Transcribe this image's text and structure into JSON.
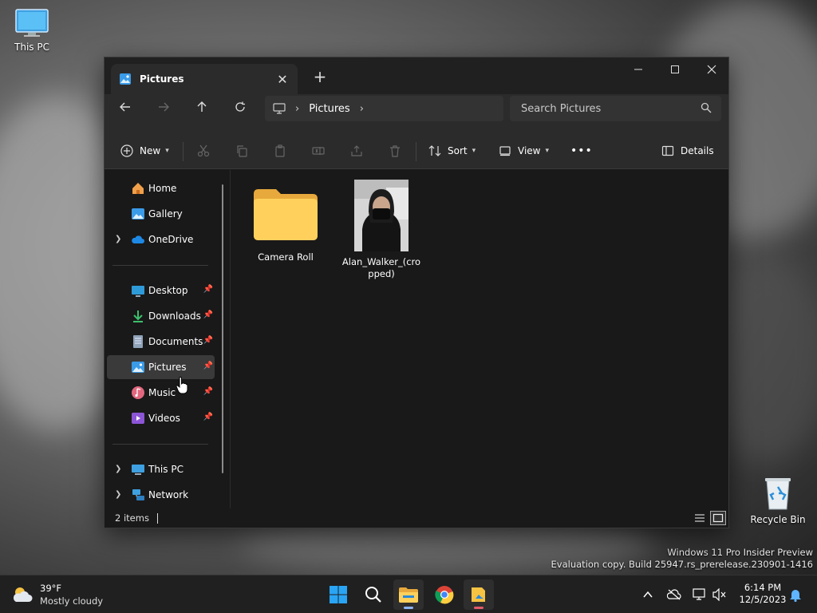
{
  "desktop": {
    "icons": [
      {
        "label": "This PC"
      },
      {
        "label": "Recycle Bin"
      }
    ],
    "watermark": {
      "line1": "Windows 11 Pro Insider Preview",
      "line2": "Evaluation copy. Build 25947.rs_prerelease.230901-1416"
    }
  },
  "window": {
    "tab": {
      "title": "Pictures",
      "close": "✕"
    },
    "new_tab": "+",
    "controls": {
      "minimize": "—",
      "maximize": "☐",
      "close": "✕"
    },
    "address": {
      "root_icon": "computer-icon",
      "crumbs": [
        {
          "label": "Pictures"
        }
      ],
      "search_placeholder": "Search Pictures"
    },
    "toolbar": {
      "new_label": "New",
      "sort_label": "Sort",
      "view_label": "View",
      "more_label": "•••",
      "details_label": "Details"
    },
    "sidebar": {
      "items": [
        {
          "label": "Home"
        },
        {
          "label": "Gallery"
        },
        {
          "label": "OneDrive"
        },
        {
          "label": "Desktop"
        },
        {
          "label": "Downloads"
        },
        {
          "label": "Documents"
        },
        {
          "label": "Pictures"
        },
        {
          "label": "Music"
        },
        {
          "label": "Videos"
        },
        {
          "label": "This PC"
        },
        {
          "label": "Network"
        }
      ]
    },
    "files": [
      {
        "name": "Camera Roll",
        "type": "folder"
      },
      {
        "name_line1": "Alan_Walker_(cro",
        "name_line2": "pped)",
        "type": "image"
      }
    ],
    "status": {
      "count": "2 items"
    }
  },
  "taskbar": {
    "weather": {
      "temp": "39°F",
      "condition": "Mostly cloudy"
    },
    "clock": {
      "time": "6:14 PM",
      "date": "12/5/2023"
    },
    "accent": "#0078d4"
  }
}
